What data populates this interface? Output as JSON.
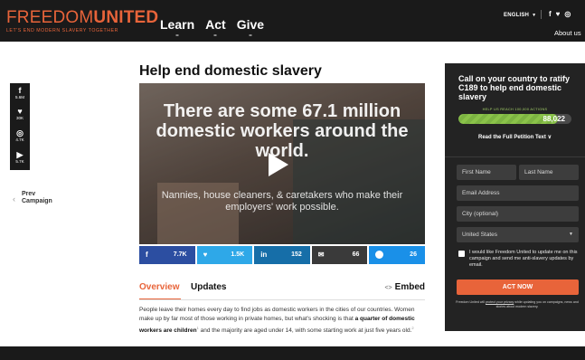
{
  "header": {
    "logo_light": "FREEDOM",
    "logo_bold": "UNITED",
    "tagline": "LET'S END MODERN SLAVERY TOGETHER",
    "nav": [
      "Learn",
      "Act",
      "Give"
    ],
    "language": "ENGLISH",
    "social_icons": [
      "f",
      "♥",
      "◎"
    ],
    "about": "About us"
  },
  "rail": {
    "items": [
      {
        "icon": "f",
        "count": "5.6M"
      },
      {
        "icon": "♥",
        "count": "30K"
      },
      {
        "icon": "◎",
        "count": "4.7K"
      },
      {
        "icon": "▶",
        "count": "5.7K"
      }
    ]
  },
  "prev": {
    "line1": "Prev",
    "line2": "Campaign"
  },
  "page": {
    "title": "Help end domestic slavery"
  },
  "video": {
    "headline": "There are some 67.1 million domestic workers around the world.",
    "subline": "Nannies, house cleaners, & caretakers who make their employers' work possible."
  },
  "share": [
    {
      "icon": "f",
      "count": "7.7K"
    },
    {
      "icon": "♥",
      "count": "1.5K"
    },
    {
      "icon": "in",
      "count": "152"
    },
    {
      "icon": "✉",
      "count": "66"
    },
    {
      "icon": "",
      "count": "26"
    }
  ],
  "tabs": {
    "overview": "Overview",
    "updates": "Updates",
    "embed_icon": "<>",
    "embed": "Embed"
  },
  "body": {
    "p1": "People leave their homes every day to find jobs as domestic workers in the cities of our countries. Women make up by far most of those working in private homes, but what's shocking is that ",
    "bold1": "a quarter of domestic workers are children",
    "sup1": "1",
    "p2": " and the majority are aged under 14, with some starting work at just five years old.",
    "sup2": "2"
  },
  "panel": {
    "title": "Call on your country to ratify C189 to help end domestic slavery",
    "progress_caption": "HELP US REACH 100,000 ACTIONS",
    "progress_fraction": 0.88,
    "progress_count": "88,022",
    "read_link": "Read the Full Petition Text",
    "read_chevron": "∨",
    "first_name": "First Name",
    "last_name": "Last Name",
    "email": "Email Address",
    "city": "City (optional)",
    "country": "United States",
    "country_caret": "▼",
    "checkbox_label": "I would like Freedom United to update me on this campaign and send me anti-slavery updates by email.",
    "action_button": "ACT NOW",
    "fine_pre": "Freedom United will ",
    "fine_link": "protect your privacy",
    "fine_post": " while updating you on campaigns, news and stories about modern slavery."
  },
  "colors": {
    "brand_orange": "#e8643a",
    "dark": "#1a1a1a",
    "progress_green": "#8bc34a"
  }
}
